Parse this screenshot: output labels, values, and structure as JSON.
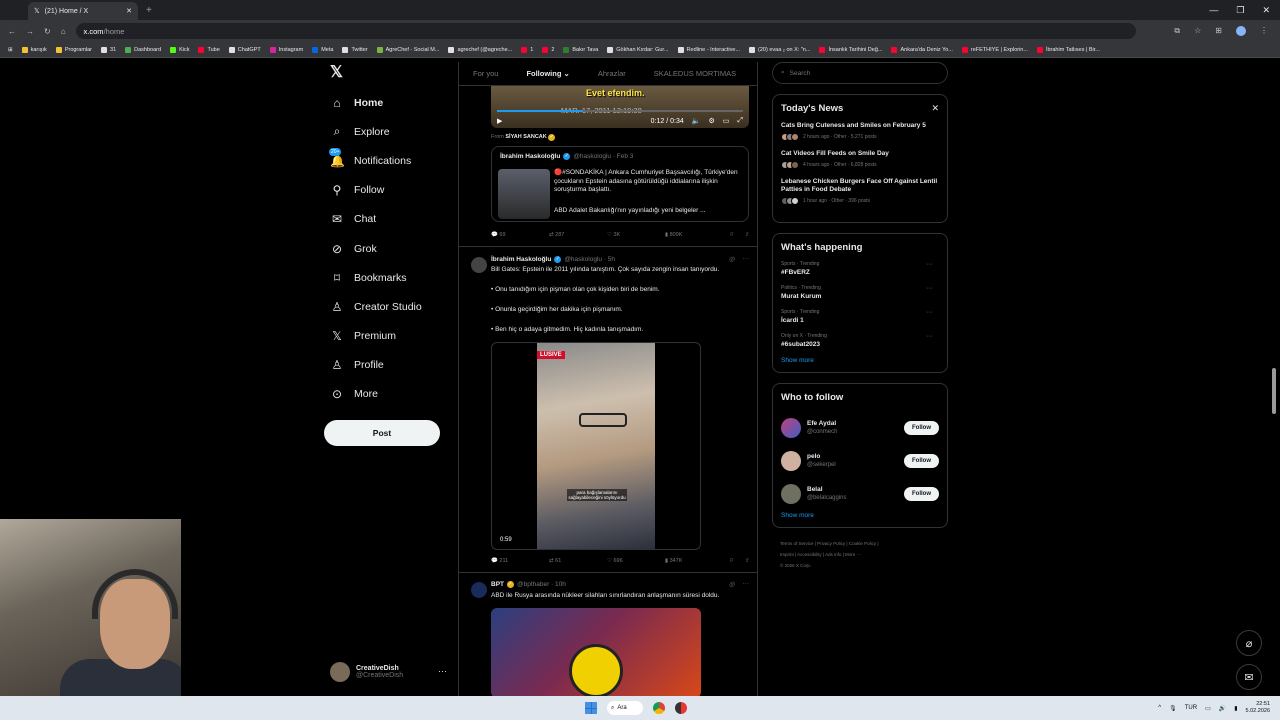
{
  "browser": {
    "tab_title": "(21) Home / X",
    "url_host": "x.com",
    "url_path": "/home",
    "bookmarks": [
      "karışık",
      "Programlar",
      "31",
      "Dashboard",
      "Kick",
      "Tube",
      "ChatGPT",
      "Instagram",
      "Meta",
      "Twitter",
      "AgreChef - Social M...",
      "agrechef (@agreche...",
      "1",
      "2",
      "Bakır Tava",
      "Gökhan Kırdar: Gur...",
      "Redline - Interactive...",
      "(20) evaa ₂ on X: \"n...",
      "İnsanlık Tarihini Değ...",
      "Ankara'da Deniz Yo...",
      "reFETHIYE | Explorin...",
      "İbrahim Tatlıses | Bir..."
    ]
  },
  "nav": {
    "items": [
      {
        "label": "Home",
        "icon": "home-icon"
      },
      {
        "label": "Explore",
        "icon": "search-icon"
      },
      {
        "label": "Notifications",
        "icon": "bell-icon",
        "badge": "20+"
      },
      {
        "label": "Follow",
        "icon": "person-add-icon"
      },
      {
        "label": "Chat",
        "icon": "mail-icon"
      },
      {
        "label": "Grok",
        "icon": "grok-icon"
      },
      {
        "label": "Bookmarks",
        "icon": "bookmark-icon"
      },
      {
        "label": "Creator Studio",
        "icon": "creator-icon"
      },
      {
        "label": "Premium",
        "icon": "x-icon"
      },
      {
        "label": "Profile",
        "icon": "person-icon"
      },
      {
        "label": "More",
        "icon": "more-icon"
      }
    ],
    "post_label": "Post",
    "account_name": "CreativeDish",
    "account_handle": "@CreativeDish"
  },
  "feed": {
    "tabs": [
      "For you",
      "Following",
      "Ahrazlar",
      "SKALEDUS MORTIMAS"
    ],
    "video1": {
      "caption": "Evet efendim.",
      "date": "MAR. 17, 2011 12:19:38",
      "time": "0:12 / 0:34",
      "progress": 0.35
    },
    "from_label": "From",
    "from_name": "SİYAH SANCAK",
    "quote": {
      "name": "İbrahim Haskoloğlu",
      "handle": "@haskologlu · Feb 3",
      "text": "🔴#SONDAKİKA | Ankara Cumhuriyet Başsavcılığı, Türkiye'den çocukların Epstein adasına götürüldüğü iddialarına ilişkin soruşturma başlattı.",
      "text2": "ABD Adalet Bakanlığı'nın yayınladığı yeni belgeler ..."
    },
    "actions1": {
      "reply": "69",
      "repost": "287",
      "like": "3K",
      "views": "809K"
    },
    "tweet2": {
      "name": "İbrahim Haskoloğlu",
      "handle": "@haskologlu · 5h",
      "line1": "Bill Gates: Epstein ile 2011 yılında tanıştım. Çok sayıda zengin insan tanıyordu.",
      "line2": "• Onu tanıdığım için pişman olan çok kişiden biri de benim.",
      "line3": "• Onunla geçirdiğim her dakika için pişmanım.",
      "line4": "• Ben hiç o adaya gitmedim. Hiç kadınla tanışmadım.",
      "video_label": "LUSIVE",
      "video_sub": "para bağışlamalarını sağlayabileceğini söylüyordu",
      "duration": "0:59",
      "actions": {
        "reply": "211",
        "repost": "61",
        "like": "696",
        "views": "347K"
      }
    },
    "tweet3": {
      "name": "BPT",
      "handle": "@bpthaber · 10h",
      "text": "ABD ile Rusya arasında nükleer silahları sınırlandıran anlaşmanın süresi doldu."
    }
  },
  "right": {
    "search_placeholder": "Search",
    "news_title": "Today's News",
    "news": [
      {
        "title": "Cats Bring Cuteness and Smiles on February 5",
        "meta": "2 hours ago · Other · 5,271 posts"
      },
      {
        "title": "Cat Videos Fill Feeds on Smile Day",
        "meta": "4 hours ago · Other · 6,828 posts"
      },
      {
        "title": "Lebanese Chicken Burgers Face Off Against Lentil Patties in Food Debate",
        "meta": "1 hour ago · Other · 396 posts"
      }
    ],
    "happening_title": "What's happening",
    "trends": [
      {
        "cat": "Sports · Trending",
        "name": "#FBvERZ"
      },
      {
        "cat": "Politics · Trending",
        "name": "Murat Kurum"
      },
      {
        "cat": "Sports · Trending",
        "name": "İcardi 1"
      },
      {
        "cat": "Only on X · Trending",
        "name": "#6subat2023"
      }
    ],
    "show_more": "Show more",
    "who_title": "Who to follow",
    "who": [
      {
        "name": "Efe Aydal",
        "handle": "@conmech",
        "btn": "Follow"
      },
      {
        "name": "pelo",
        "handle": "@sekerpel",
        "btn": "Follow"
      },
      {
        "name": "Belal",
        "handle": "@belalcaggins",
        "btn": "Follow"
      }
    ],
    "footer1": "Terms of Service  |  Privacy Policy  |  Cookie Policy  |",
    "footer2": "Imprint  |  Accessibility  |  Ads info  |  More ···",
    "footer3": "© 2026 X Corp."
  },
  "taskbar": {
    "search": "Ara",
    "lang": "TUR",
    "time": "22:51",
    "date": "5.02.2026"
  }
}
